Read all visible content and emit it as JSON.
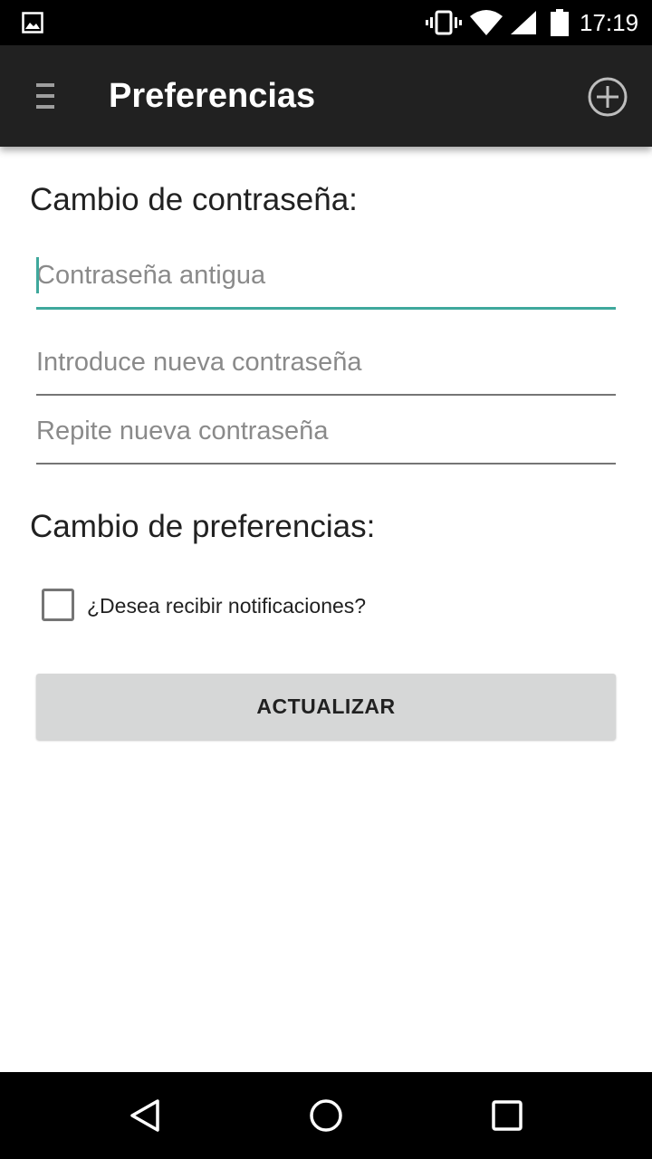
{
  "status_bar": {
    "time": "17:19",
    "icons": [
      "image-notification-icon",
      "vibrate-icon",
      "wifi-icon",
      "signal-icon",
      "battery-icon"
    ]
  },
  "action_bar": {
    "title": "Preferencias",
    "menu_icon": "menu-icon",
    "add_icon": "add-circle-icon"
  },
  "password_section": {
    "title": "Cambio de contraseña:",
    "old_password": {
      "placeholder": "Contraseña antigua",
      "value": ""
    },
    "new_password": {
      "placeholder": "Introduce nueva contraseña",
      "value": ""
    },
    "repeat_password": {
      "placeholder": "Repite nueva contraseña",
      "value": ""
    }
  },
  "preferences_section": {
    "title": "Cambio de preferencias:",
    "notifications_label": "¿Desea recibir notificaciones?",
    "notifications_checked": false
  },
  "update_button": {
    "label": "ACTUALIZAR"
  },
  "nav_bar": {
    "icons": [
      "back-icon",
      "home-icon",
      "recents-icon"
    ]
  },
  "colors": {
    "action_bar_bg": "#212121",
    "accent": "#3fa89c",
    "button_bg": "#d6d7d7"
  }
}
